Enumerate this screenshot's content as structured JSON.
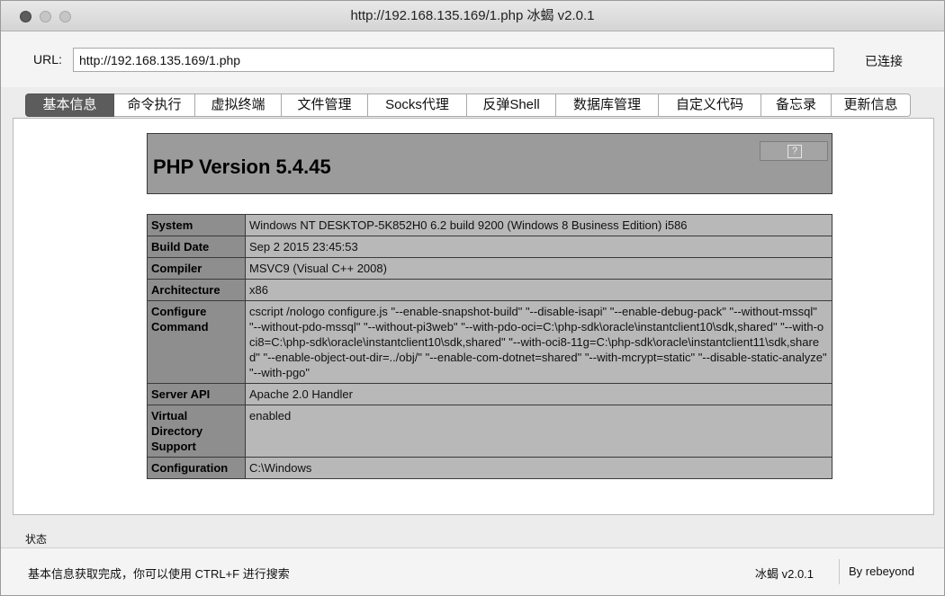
{
  "window": {
    "title": "http://192.168.135.169/1.php   冰蝎 v2.0.1"
  },
  "urlbar": {
    "label": "URL:",
    "value": "http://192.168.135.169/1.php",
    "status": "已连接"
  },
  "tabs": [
    {
      "label": "基本信息",
      "active": true
    },
    {
      "label": "命令执行"
    },
    {
      "label": "虚拟终端"
    },
    {
      "label": "文件管理"
    },
    {
      "label": "Socks代理"
    },
    {
      "label": "反弹Shell"
    },
    {
      "label": "数据库管理"
    },
    {
      "label": "自定义代码"
    },
    {
      "label": "备忘录"
    },
    {
      "label": "更新信息"
    }
  ],
  "phpinfo": {
    "version": "PHP Version 5.4.45",
    "help": "?",
    "rows": [
      {
        "key": "System",
        "value": "Windows NT DESKTOP-5K852H0 6.2 build 9200 (Windows 8 Business Edition) i586"
      },
      {
        "key": "Build Date",
        "value": "Sep 2 2015 23:45:53"
      },
      {
        "key": "Compiler",
        "value": "MSVC9 (Visual C++ 2008)"
      },
      {
        "key": "Architecture",
        "value": "x86"
      },
      {
        "key": "Configure Command",
        "value": "cscript /nologo configure.js \"--enable-snapshot-build\" \"--disable-isapi\" \"--enable-debug-pack\" \"--without-mssql\" \"--without-pdo-mssql\" \"--without-pi3web\" \"--with-pdo-oci=C:\\php-sdk\\oracle\\instantclient10\\sdk,shared\" \"--with-oci8=C:\\php-sdk\\oracle\\instantclient10\\sdk,shared\" \"--with-oci8-11g=C:\\php-sdk\\oracle\\instantclient11\\sdk,shared\" \"--enable-object-out-dir=../obj/\" \"--enable-com-dotnet=shared\" \"--with-mcrypt=static\" \"--disable-static-analyze\" \"--with-pgo\""
      },
      {
        "key": "Server API",
        "value": "Apache 2.0 Handler"
      },
      {
        "key": "Virtual Directory Support",
        "value": "enabled"
      },
      {
        "key": "Configuration",
        "value": "C:\\Windows"
      }
    ]
  },
  "status": {
    "label": "状态",
    "message": "基本信息获取完成，你可以使用 CTRL+F 进行搜索",
    "version": "冰蝎 v2.0.1",
    "author": "By rebeyond"
  }
}
